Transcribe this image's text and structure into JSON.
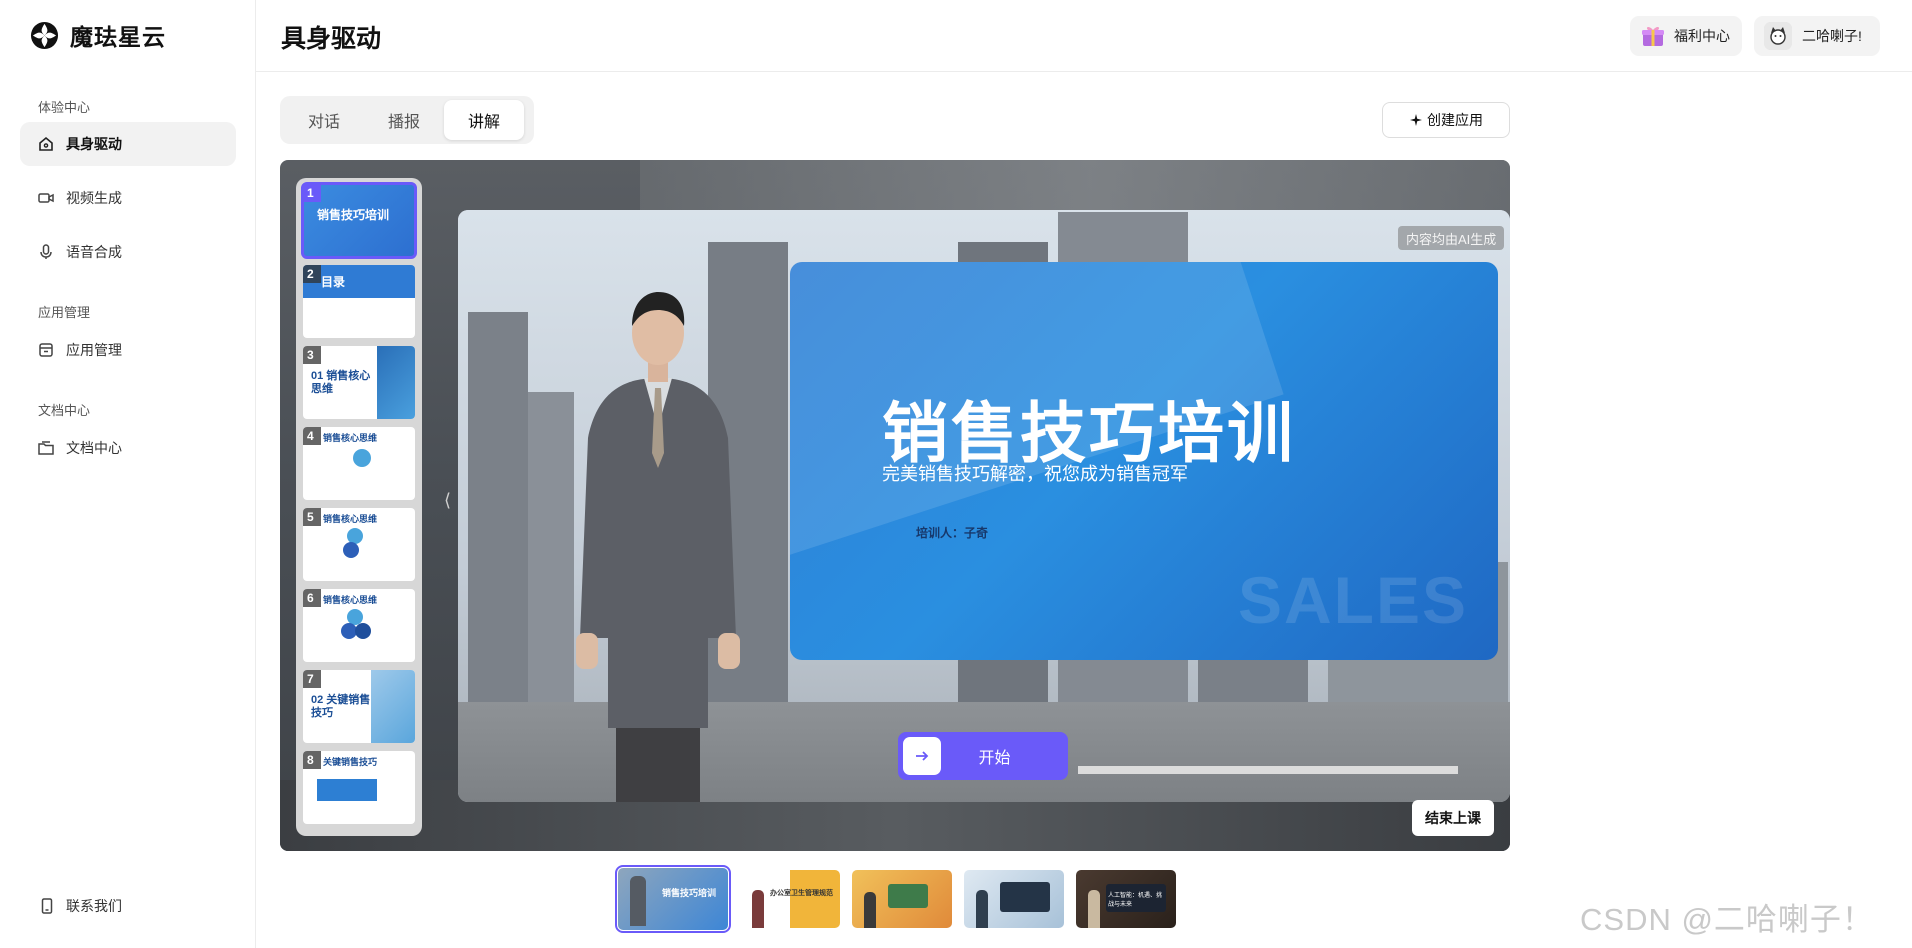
{
  "brand": {
    "name": "魔珐星云",
    "logo_icon": "clover-logo-icon"
  },
  "sidebar": {
    "groups": [
      {
        "title": "体验中心",
        "items": [
          {
            "label": "具身驱动",
            "icon": "home-icon",
            "active": true
          },
          {
            "label": "视频生成",
            "icon": "video-camera-icon"
          },
          {
            "label": "语音合成",
            "icon": "microphone-icon"
          }
        ]
      },
      {
        "title": "应用管理",
        "items": [
          {
            "label": "应用管理",
            "icon": "app-box-icon"
          }
        ]
      },
      {
        "title": "文档中心",
        "items": [
          {
            "label": "文档中心",
            "icon": "folder-icon"
          }
        ]
      }
    ],
    "contact_label": "联系我们"
  },
  "header": {
    "title": "具身驱动",
    "welfare_label": "福利中心",
    "user_name": "二哈喇子!"
  },
  "tabs": [
    {
      "label": "对话"
    },
    {
      "label": "播报"
    },
    {
      "label": "讲解",
      "active": true
    }
  ],
  "create_app_label": "创建应用",
  "thumbnails": [
    {
      "num": "1",
      "title": "销售技巧培训"
    },
    {
      "num": "2",
      "title": "目录"
    },
    {
      "num": "3",
      "title": "01 销售核心思维"
    },
    {
      "num": "4",
      "title": "销售核心思维"
    },
    {
      "num": "5",
      "title": "销售核心思维"
    },
    {
      "num": "6",
      "title": "销售核心思维"
    },
    {
      "num": "7",
      "title": "02 关键销售技巧"
    },
    {
      "num": "8",
      "title": "关键销售技巧"
    }
  ],
  "ai_tag": "内容均由AI生成",
  "slide": {
    "title": "销售技巧培训",
    "subtitle": "完美销售技巧解密，祝您成为销售冠军",
    "trainer": "培训人：子奇",
    "watermark": "SALES"
  },
  "start_label": "开始",
  "end_label": "结束上课",
  "scenes": [
    {
      "label": "销售技巧培训",
      "active": true
    },
    {
      "label": "办公室卫生管理规范"
    },
    {
      "label": ""
    },
    {
      "label": ""
    },
    {
      "label": "人工智能：机遇、挑战与未来"
    }
  ],
  "watermark": "CSDN @二哈喇子！",
  "colors": {
    "accent": "#6a5af9",
    "slide_blue": "#2a8fe0"
  }
}
